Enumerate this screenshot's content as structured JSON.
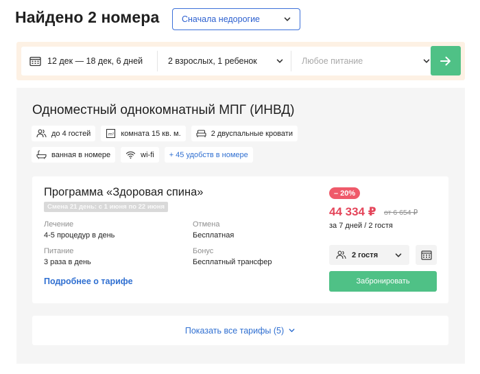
{
  "header": {
    "title": "Найдено 2 номера",
    "sort": {
      "selected": "Сначала недорогие"
    }
  },
  "search": {
    "dates": "12 дек — 18 дек, 6 дней",
    "guests": "2 взрослых, 1 ребенок",
    "food_placeholder": "Любое питание"
  },
  "room": {
    "name": "Одноместный однокомнатный МПГ (ИНВД)",
    "amenities": [
      {
        "icon": "guests-icon",
        "label": "до 4 гостей"
      },
      {
        "icon": "area-icon",
        "label": "комната 15 кв. м."
      },
      {
        "icon": "bed-icon",
        "label": "2 двуспальные кровати"
      },
      {
        "icon": "bath-icon",
        "label": "ванная в номере"
      },
      {
        "icon": "wifi-icon",
        "label": "wi-fi"
      }
    ],
    "more_amenities": "+ 45 удобств в номере",
    "tariff": {
      "name": "Программа «Здоровая спина»",
      "shift": "Смена 21 день: с 1 июня по 22 июня",
      "treatment_label": "Лечение",
      "treatment_value": "4-5 процедур в день",
      "cancel_label": "Отмена",
      "cancel_value": "Бесплатная",
      "food_label": "Питание",
      "food_value": "3 раза в день",
      "bonus_label": "Бонус",
      "bonus_value": "Бесплатный трансфер",
      "details_link": "Подробнее о тарифе",
      "discount": "– 20%",
      "price": "44 334 ₽",
      "old_price": "от 6 654 ₽",
      "per": "за 7 дней / 2 гостя",
      "guests_selected": "2 гостя",
      "book_label": "Забронировать"
    },
    "show_all": "Показать все тарифы (5)"
  },
  "colors": {
    "accent_blue": "#2f6fd1",
    "green": "#4fc186",
    "price_red": "#e4455a",
    "badge_red": "#ef5a6a",
    "search_bg": "#fdf1e4"
  }
}
